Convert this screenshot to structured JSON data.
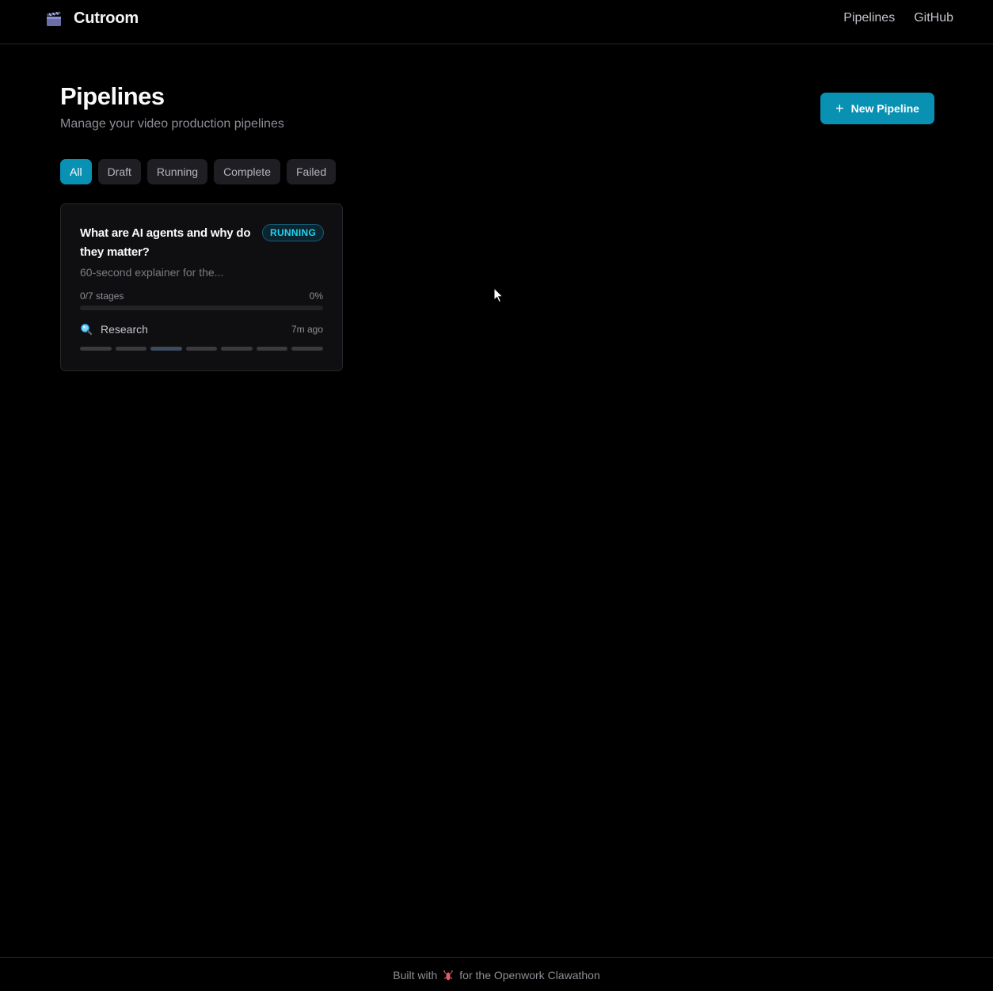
{
  "header": {
    "brand": "Cutroom",
    "brand_icon": "clapperboard-icon",
    "nav": [
      "Pipelines",
      "GitHub"
    ]
  },
  "page": {
    "title": "Pipelines",
    "subtitle": "Manage your video production pipelines",
    "new_button": "New Pipeline",
    "new_button_icon": "plus-icon"
  },
  "filters": [
    "All",
    "Draft",
    "Running",
    "Complete",
    "Failed"
  ],
  "active_filter": "All",
  "pipelines": [
    {
      "title": "What are AI agents and why do they matter?",
      "status": "RUNNING",
      "description": "60-second explainer for the...",
      "stages_label": "0/7 stages",
      "percent_label": "0%",
      "progress": 0,
      "current_stage": "Research",
      "current_stage_icon": "magnifier-icon",
      "age": "7m ago",
      "total_stages": 7,
      "current_stage_index": 2
    }
  ],
  "footer": {
    "before": "Built with",
    "icon": "lobster-icon",
    "after": "for the Openwork Clawathon"
  },
  "colors": {
    "accent": "#0891b2",
    "running_badge": "#22d3ee",
    "background": "#000000"
  }
}
